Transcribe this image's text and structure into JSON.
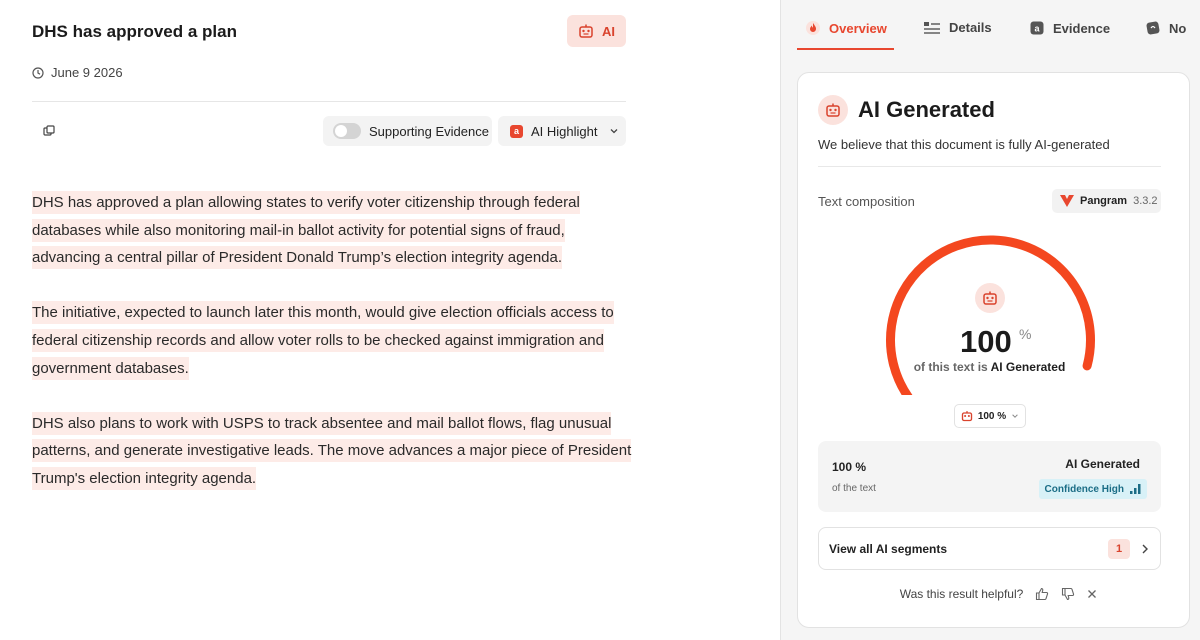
{
  "document": {
    "title": "DHS has approved a plan",
    "ai_chip_label": "AI",
    "date": "June 9 2026",
    "supporting_evidence_label": "Supporting Evidence",
    "ai_highlight_label": "AI Highlight",
    "paragraphs": [
      "DHS has approved a plan allowing states to verify voter citizenship through federal databases while also monitoring mail-in ballot activity for potential signs of fraud, advancing a central pillar of President Donald Trump’s election integrity agenda.",
      "The initiative, expected to launch later this month, would give election officials access to federal citizenship records and allow voter rolls to be checked against immigration and government databases.",
      "DHS also plans to work with USPS to track absentee and mail ballot flows, flag unusual patterns, and generate investigative leads. The move advances a major piece of President Trump's election integrity agenda."
    ]
  },
  "panel": {
    "tabs": [
      {
        "label": "Overview",
        "icon": "flame-icon",
        "active": true
      },
      {
        "label": "Details",
        "icon": "list-icon",
        "active": false
      },
      {
        "label": "Evidence",
        "icon": "evidence-icon",
        "active": false
      },
      {
        "label": "No",
        "icon": "notes-icon",
        "active": false
      }
    ],
    "card": {
      "title": "AI Generated",
      "subtitle": "We believe that this document is fully AI-generated",
      "composition_label": "Text composition",
      "model_name": "Pangram",
      "model_version": "3.3.2",
      "gauge": {
        "value": "100",
        "unit": "%",
        "fraction": 1.0,
        "caption_prefix": "of this text is",
        "caption_accent": "AI Generated",
        "color": "#f4471f"
      },
      "percent_select": "100 %",
      "stat": {
        "value": "100 %",
        "of_text": "of the text",
        "label": "AI Generated",
        "confidence": "Confidence High"
      },
      "segments_label": "View all AI segments",
      "segments_count": "1",
      "helpful_question": "Was this result helpful?"
    }
  },
  "colors": {
    "accent": "#e8472f",
    "highlight": "#fdebe7",
    "chip_bg": "#fbe2dd",
    "confidence_bg": "#d8f1f7"
  }
}
